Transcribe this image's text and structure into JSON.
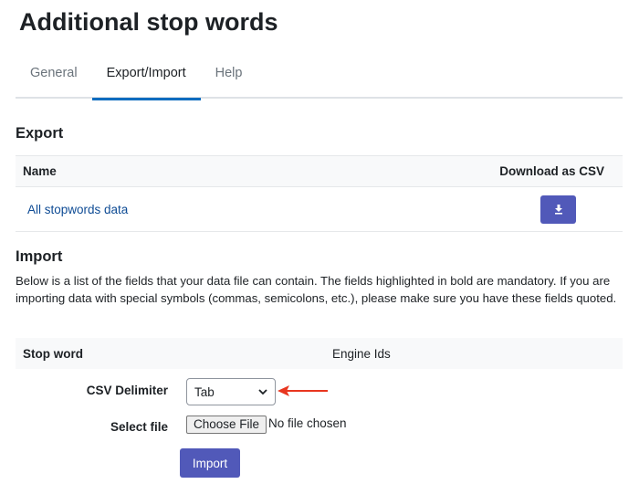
{
  "page": {
    "title": "Additional stop words"
  },
  "tabs": [
    {
      "label": "General",
      "active": false
    },
    {
      "label": "Export/Import",
      "active": true
    },
    {
      "label": "Help",
      "active": false
    }
  ],
  "export": {
    "heading": "Export",
    "columns": [
      "Name",
      "Download as CSV"
    ],
    "rows": [
      {
        "name": "All stopwords data",
        "action_icon": "download-icon"
      }
    ]
  },
  "import": {
    "heading": "Import",
    "description": "Below is a list of the fields that your data file can contain. The fields highlighted in bold are mandatory. If you are importing data with special symbols (commas, semicolons, etc.), please make sure you have these fields quoted.",
    "fields": [
      "Stop word",
      "Engine Ids"
    ],
    "csv_delimiter_label": "CSV Delimiter",
    "csv_delimiter_value": "Tab",
    "select_file_label": "Select file",
    "choose_file_label": "Choose File",
    "file_status": "No file chosen",
    "import_button_label": "Import"
  },
  "colors": {
    "primary_button": "#5159b9",
    "link": "#0f4c95",
    "annotation_arrow": "#e8361f",
    "active_tab_underline": "#0f6cbf"
  }
}
